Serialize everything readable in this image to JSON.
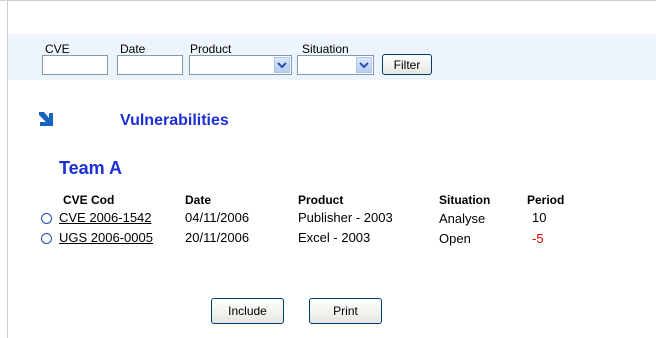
{
  "filters": {
    "cve_label": "CVE",
    "date_label": "Date",
    "product_label": "Product",
    "situation_label": "Situation",
    "cve_value": "",
    "date_value": "",
    "product_value": "",
    "situation_value": "",
    "filter_button": "Filter"
  },
  "section_title": "Vulnerabilities",
  "team_title": "Team A",
  "table": {
    "headers": [
      "CVE Cod",
      "Date",
      "Product",
      "Situation",
      "Period"
    ],
    "rows": [
      {
        "cve": "CVE 2006-1542",
        "date": "04/11/2006",
        "product": "Publisher - 2003",
        "situation": "Analyse",
        "period": "10"
      },
      {
        "cve": "UGS 2006-0005",
        "date": "20/11/2006",
        "product": "Excel - 2003",
        "situation": "Open",
        "period": "-5"
      }
    ]
  },
  "actions": {
    "include_label": "Include",
    "print_label": "Print"
  },
  "colors": {
    "title_blue": "#1a2fd6",
    "negative_red": "#e00000",
    "filter_bar_bg": "#eef4fb",
    "arrow_icon_color": "#1565c0"
  },
  "icons": {
    "section_icon": "arrow-down-right-icon",
    "dropdown_icon": "chevron-down-icon",
    "radio_icon": "radio-button-icon"
  }
}
